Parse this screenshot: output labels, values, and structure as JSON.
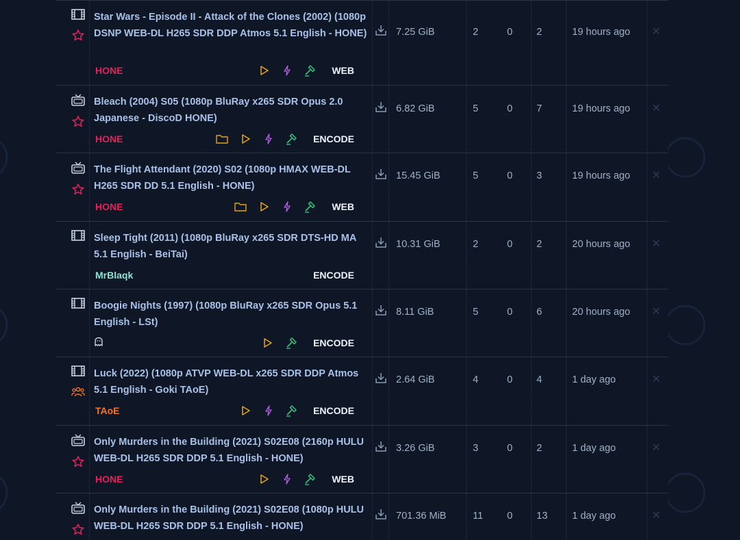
{
  "colors": {
    "background": "#0f1726",
    "title": "#a9c1e8",
    "hone": "#e6205a",
    "mrblaqk": "#8fe0d0",
    "taoe": "#f0772a",
    "play": "#e8a317",
    "bolt": "#b65ce6",
    "hammer": "#33c17c",
    "folder": "#e8a317"
  },
  "rows": [
    {
      "type_icon": "film-icon",
      "flag_icon": "star-icon",
      "title": "Star Wars - Episode II - Attack of the Clones (2002) (1080p DSNP WEB-DL H265 SDR DDP Atmos 5.1 English - HONE)",
      "group": "HONE",
      "group_color": "#e6205a",
      "tag_icons": [
        "play-icon",
        "bolt-icon",
        "hammer-icon"
      ],
      "tag_label": "WEB",
      "size": "7.25 GiB",
      "seeders": "2",
      "leechers": "0",
      "completed": "2",
      "age": "19 hours ago"
    },
    {
      "type_icon": "tv-icon",
      "flag_icon": "star-icon",
      "title": "Bleach (2004) S05 (1080p BluRay x265 SDR Opus 2.0 Japanese - DiscoD HONE)",
      "group": "HONE",
      "group_color": "#e6205a",
      "tag_icons": [
        "folder-icon",
        "play-icon",
        "bolt-icon",
        "hammer-icon"
      ],
      "tag_label": "ENCODE",
      "size": "6.82 GiB",
      "seeders": "5",
      "leechers": "0",
      "completed": "7",
      "age": "19 hours ago"
    },
    {
      "type_icon": "tv-icon",
      "flag_icon": "star-icon",
      "title": "The Flight Attendant (2020) S02 (1080p HMAX WEB-DL H265 SDR DD 5.1 English - HONE)",
      "group": "HONE",
      "group_color": "#e6205a",
      "tag_icons": [
        "folder-icon",
        "play-icon",
        "bolt-icon",
        "hammer-icon"
      ],
      "tag_label": "WEB",
      "size": "15.45 GiB",
      "seeders": "5",
      "leechers": "0",
      "completed": "3",
      "age": "19 hours ago"
    },
    {
      "type_icon": "film-icon",
      "flag_icon": "",
      "title": "Sleep Tight (2011) (1080p BluRay x265 SDR DTS-HD MA 5.1 English - BeiTai)",
      "group": "MrBlaqk",
      "group_color": "#8fe0d0",
      "tag_icons": [],
      "tag_label": "ENCODE",
      "size": "10.31 GiB",
      "seeders": "2",
      "leechers": "0",
      "completed": "2",
      "age": "20 hours ago"
    },
    {
      "type_icon": "film-icon",
      "flag_icon": "",
      "title": "Boogie Nights (1997) (1080p BluRay x265 SDR Opus 5.1 English - LSt)",
      "group": "",
      "group_color": "#c9d3e3",
      "group_icon": "ghost-icon",
      "tag_icons": [
        "play-icon",
        "hammer-icon"
      ],
      "tag_label": "ENCODE",
      "size": "8.11 GiB",
      "seeders": "5",
      "leechers": "0",
      "completed": "6",
      "age": "20 hours ago"
    },
    {
      "type_icon": "film-icon",
      "flag_icon": "users-icon",
      "title": "Luck (2022) (1080p ATVP WEB-DL x265 SDR DDP Atmos 5.1 English - Goki TAoE)",
      "group": "TAoE",
      "group_color": "#f0772a",
      "tag_icons": [
        "play-icon",
        "bolt-icon",
        "hammer-icon"
      ],
      "tag_label": "ENCODE",
      "size": "2.64 GiB",
      "seeders": "4",
      "leechers": "0",
      "completed": "4",
      "age": "1 day ago"
    },
    {
      "type_icon": "tv-icon",
      "flag_icon": "star-icon",
      "title": "Only Murders in the Building (2021) S02E08 (2160p HULU WEB-DL H265 SDR DDP 5.1 English - HONE)",
      "group": "HONE",
      "group_color": "#e6205a",
      "tag_icons": [
        "play-icon",
        "bolt-icon",
        "hammer-icon"
      ],
      "tag_label": "WEB",
      "size": "3.26 GiB",
      "seeders": "3",
      "leechers": "0",
      "completed": "2",
      "age": "1 day ago"
    },
    {
      "type_icon": "tv-icon",
      "flag_icon": "star-icon",
      "title": "Only Murders in the Building (2021) S02E08 (1080p HULU WEB-DL H265 SDR DDP 5.1 English - HONE)",
      "group": "",
      "group_color": "#e6205a",
      "tag_icons": [],
      "tag_label": "",
      "size": "701.36 MiB",
      "seeders": "11",
      "leechers": "0",
      "completed": "13",
      "age": "1 day ago"
    }
  ]
}
